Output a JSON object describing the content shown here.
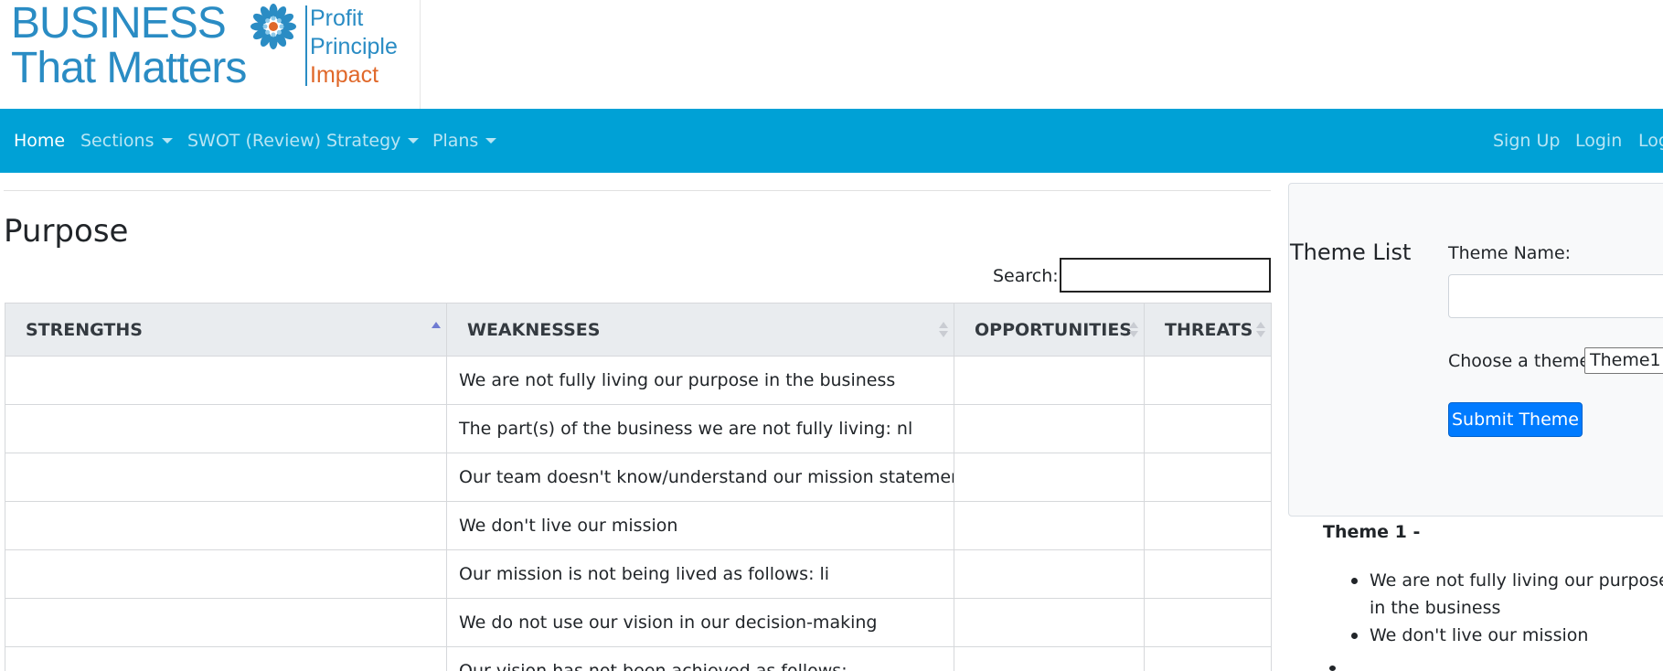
{
  "logo": {
    "line1": "BUSINESS",
    "line2": "That Matters",
    "tag1": "Profit",
    "tag2": "Principle",
    "tag3": "Impact",
    "colors": {
      "blue": "#2a8cc4",
      "orange": "#e0682a"
    }
  },
  "nav": {
    "left": [
      {
        "label": "Home"
      },
      {
        "label": "Sections"
      },
      {
        "label": "SWOT (Review)"
      },
      {
        "label": "Strategy"
      },
      {
        "label": "Plans"
      }
    ],
    "right": [
      {
        "label": "Sign Up"
      },
      {
        "label": "Login"
      },
      {
        "label": "Log"
      }
    ],
    "color": "#00a1d6"
  },
  "page": {
    "title": "Purpose",
    "search_label": "Search:",
    "search_value": ""
  },
  "table": {
    "headers": [
      "STRENGTHS",
      "WEAKNESSES",
      "OPPORTUNITIES",
      "THREATS"
    ],
    "rows": [
      [
        "",
        "We are not fully living our purpose in the business",
        "",
        ""
      ],
      [
        "",
        "The part(s) of the business we are not fully living:  nl",
        "",
        ""
      ],
      [
        "",
        "Our team doesn't know/understand our mission statement",
        "",
        ""
      ],
      [
        "",
        "We don't live our mission",
        "",
        ""
      ],
      [
        "",
        "Our mission is not being lived as follows:  li",
        "",
        ""
      ],
      [
        "",
        "We do not use our vision in our decision-making",
        "",
        ""
      ],
      [
        "",
        "Our vision has not been achieved as follows:",
        "",
        ""
      ]
    ]
  },
  "theme_panel": {
    "heading": "Theme List",
    "name_label": "Theme Name:",
    "name_value": "",
    "choose_label": "Choose a theme",
    "selected_option": "Theme1",
    "submit_label": "Submit Theme"
  },
  "theme1": {
    "title": "Theme 1 -",
    "items": [
      "We are not fully living our purpose in the business",
      "We don't live our mission"
    ]
  }
}
